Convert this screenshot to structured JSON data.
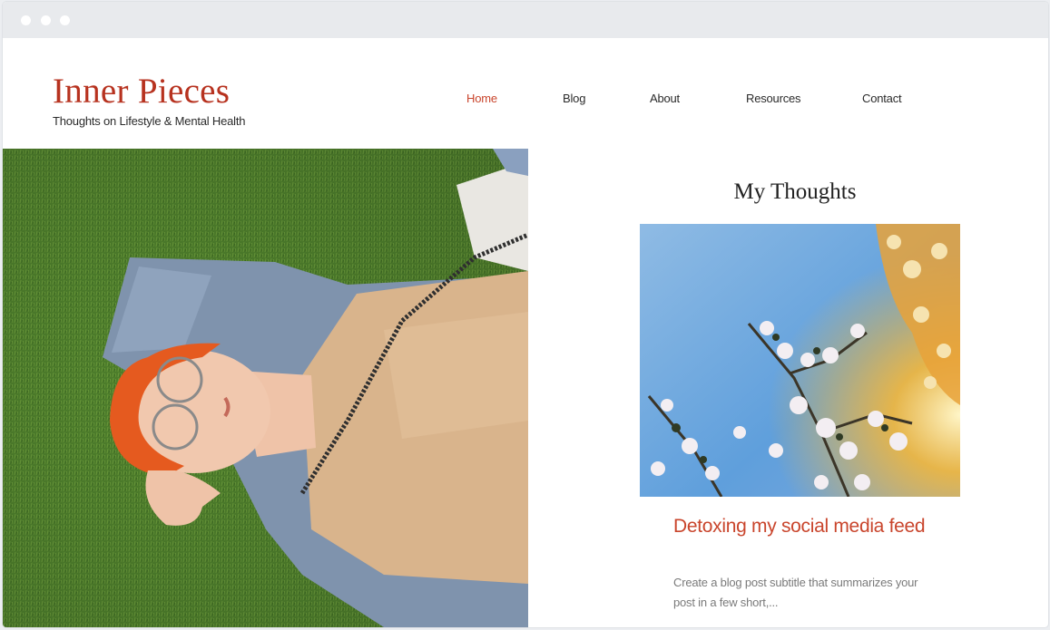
{
  "site": {
    "title": "Inner Pieces",
    "tagline": "Thoughts on Lifestyle & Mental Health"
  },
  "nav": {
    "items": [
      {
        "label": "Home",
        "active": true
      },
      {
        "label": "Blog",
        "active": false
      },
      {
        "label": "About",
        "active": false
      },
      {
        "label": "Resources",
        "active": false
      },
      {
        "label": "Contact",
        "active": false
      }
    ]
  },
  "hero": {
    "image": "woman-lying-on-grass-photo"
  },
  "blog": {
    "section_title": "My Thoughts",
    "post": {
      "image": "cherry-blossom-sky-photo",
      "title": "Detoxing my social media feed",
      "subtitle": "Create a blog post subtitle that summarizes your post in a few short,..."
    }
  },
  "colors": {
    "accent": "#c9452c",
    "logo": "#b7321f",
    "text": "#2b2b2b",
    "muted": "#7a7a7a"
  }
}
